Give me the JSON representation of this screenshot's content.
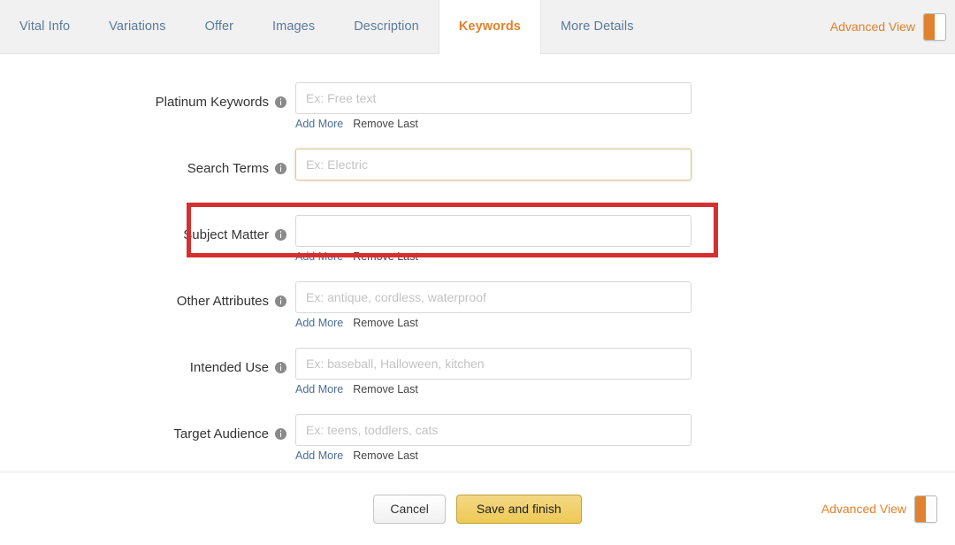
{
  "tabs": [
    {
      "label": "Vital Info",
      "active": false
    },
    {
      "label": "Variations",
      "active": false
    },
    {
      "label": "Offer",
      "active": false
    },
    {
      "label": "Images",
      "active": false
    },
    {
      "label": "Description",
      "active": false
    },
    {
      "label": "Keywords",
      "active": true
    },
    {
      "label": "More Details",
      "active": false
    }
  ],
  "advanced_view": {
    "label": "Advanced View",
    "toggle_state": "on",
    "toggle_on_color": "#e0822f"
  },
  "form": {
    "fields": [
      {
        "label": "Platinum Keywords",
        "placeholder": "Ex: Free text",
        "value": "",
        "focused": false,
        "has_actions": true,
        "add_more": "Add More",
        "remove_last": "Remove Last"
      },
      {
        "label": "Search Terms",
        "placeholder": "Ex: Electric",
        "value": "",
        "focused": true,
        "has_actions": false,
        "add_more": "",
        "remove_last": ""
      },
      {
        "label": "Subject Matter",
        "placeholder": "",
        "value": "",
        "focused": false,
        "has_actions": true,
        "add_more": "Add More",
        "remove_last": "Remove Last"
      },
      {
        "label": "Other Attributes",
        "placeholder": "Ex: antique, cordless, waterproof",
        "value": "",
        "focused": false,
        "has_actions": true,
        "add_more": "Add More",
        "remove_last": "Remove Last"
      },
      {
        "label": "Intended Use",
        "placeholder": "Ex: baseball, Halloween, kitchen",
        "value": "",
        "focused": false,
        "has_actions": true,
        "add_more": "Add More",
        "remove_last": "Remove Last"
      },
      {
        "label": "Target Audience",
        "placeholder": "Ex: teens, toddlers, cats",
        "value": "",
        "focused": false,
        "has_actions": true,
        "add_more": "Add More",
        "remove_last": "Remove Last"
      }
    ]
  },
  "highlight": {
    "target_field": "Search Terms",
    "color": "#d62f2f"
  },
  "footer": {
    "cancel_label": "Cancel",
    "save_label": "Save and finish",
    "advanced_view_label": "Advanced View"
  },
  "colors": {
    "accent_orange": "#e4802a",
    "tab_link_blue": "#5a7a9e",
    "save_button_gold": "#eec956",
    "highlight_red": "#d62f2f",
    "focus_border": "#d8c79b"
  }
}
